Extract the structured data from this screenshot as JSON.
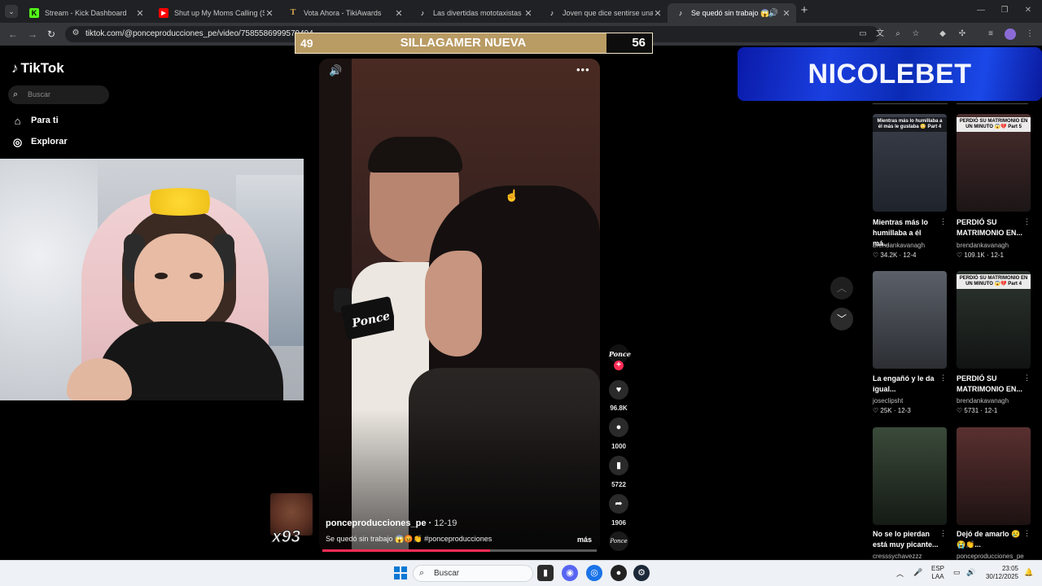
{
  "browser": {
    "tabs": [
      {
        "label": "Stream - Kick Dashboard",
        "favicon": "kick-icon",
        "color": "#53fc18",
        "active": false
      },
      {
        "label": "Shut up My Moms Calling (Spe",
        "favicon": "youtube-icon",
        "color": "#ff0000",
        "active": false
      },
      {
        "label": "Vota Ahora - TikiAwards",
        "favicon": "tikiawards-icon",
        "color": "#c9a14a",
        "active": false
      },
      {
        "label": "Las divertidas mototaxistas de",
        "favicon": "tiktok-icon",
        "color": "#000000",
        "active": false
      },
      {
        "label": "Joven que dice sentirse una p",
        "favicon": "tiktok-icon",
        "color": "#000000",
        "active": false
      },
      {
        "label": "Se quedó sin trabajo 😱😡",
        "favicon": "tiktok-icon",
        "color": "#000000",
        "active": true
      }
    ],
    "url": "tiktok.com/@ponceproducciones_pe/video/7585586999579494"
  },
  "tiktok": {
    "logo": "TikTok",
    "search_placeholder": "Buscar",
    "nav": [
      {
        "label": "Para ti",
        "icon": "home-icon"
      },
      {
        "label": "Explorar",
        "icon": "compass-icon"
      }
    ]
  },
  "scoreboard": {
    "left_score": "49",
    "title": "SILLAGAMER NUEVA",
    "right_score": "56"
  },
  "sponsor": {
    "text": "NICOLEBET"
  },
  "video": {
    "author": "ponceproducciones_pe",
    "date": "12-19",
    "caption": "Se quedó sin trabajo 😱😡👏 #ponceproducciones",
    "more_label": "más",
    "progress": 0.61,
    "creator_avatar_label": "Ponce",
    "actions": [
      {
        "icon": "heart-icon",
        "count": "96.8K"
      },
      {
        "icon": "comment-icon",
        "count": "1000"
      },
      {
        "icon": "bookmark-icon",
        "count": "5722"
      },
      {
        "icon": "share-icon",
        "count": "1906"
      }
    ]
  },
  "reaction": {
    "count": "x93"
  },
  "recommendations": [
    {
      "thumb_text": "Mientras más lo humillaba a él más le gustaba 😳 Part 4",
      "title": "Mientras más lo humillaba a él má...",
      "author": "brendankavanagh",
      "likes": "34.2K",
      "date": "12-4",
      "thumb_color": "#2b2f3a"
    },
    {
      "thumb_text": "PERDIÓ SU MATRIMONIO EN UN MINUTO 😱💔 Part 5",
      "title": "PERDIÓ SU MATRIMONIO EN...",
      "author": "brendankavanagh",
      "likes": "109.1K",
      "date": "12-1",
      "thumb_color": "#3a2a2a"
    },
    {
      "thumb_text": "",
      "title": "La engañó y le da igual...",
      "author": "joseclipsht",
      "likes": "25K",
      "date": "12-3",
      "thumb_color": "#4a4f55"
    },
    {
      "thumb_text": "PERDIÓ SU MATRIMONIO EN UN MINUTO 😱💔 Part 4",
      "title": "PERDIÓ SU MATRIMONIO EN...",
      "author": "brendankavanagh",
      "likes": "5731",
      "date": "12-1",
      "thumb_color": "#2e3530"
    },
    {
      "thumb_text": "",
      "title": "No se lo pierdan está muy picante...",
      "author": "cresssychavezzz",
      "likes": "",
      "date": "",
      "thumb_color": "#3a4038"
    },
    {
      "thumb_text": "",
      "title": "Dejó de amarlo 😢😭👏...",
      "author": "ponceproducciones_pe",
      "likes": "",
      "date": "",
      "thumb_color": "#4a2e2e"
    }
  ],
  "taskbar": {
    "search_placeholder": "Buscar",
    "lang_line1": "ESP",
    "lang_line2": "LAA",
    "time": "23:05",
    "date": "30/12/2025"
  }
}
